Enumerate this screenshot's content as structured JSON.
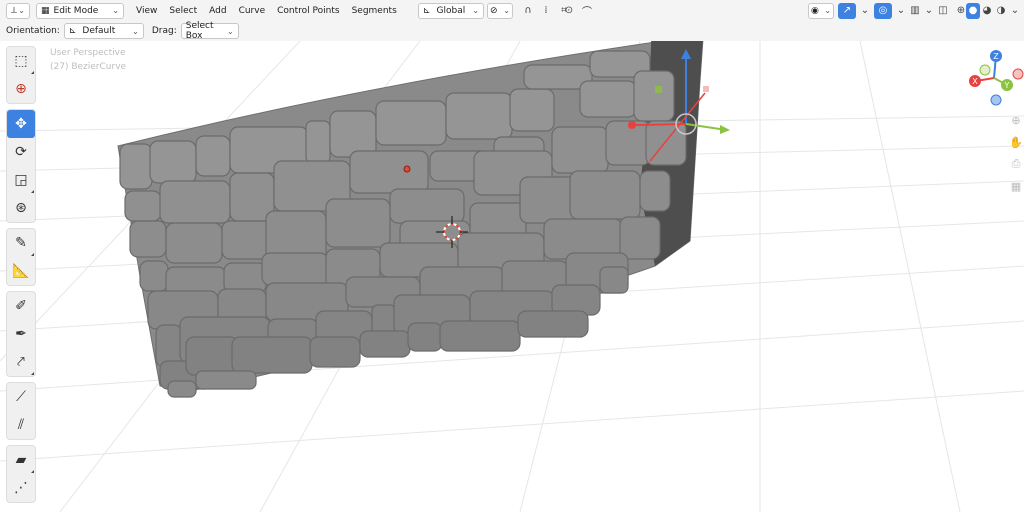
{
  "header": {
    "editor_type_icon": "axes-editor-icon",
    "mode": "Edit Mode",
    "menus": [
      "View",
      "Select",
      "Add",
      "Curve",
      "Control Points",
      "Segments"
    ],
    "transform_orientation": "Global",
    "pivot_icon": "pivot-icon",
    "snap_icon": "snap-magnet-icon",
    "proportional_icon": "proportional-edit-icon",
    "falloff_icon": "falloff-icon"
  },
  "header_right": {
    "visibility_icon": "eye-icon",
    "gizmo_icon": "gizmo-icon",
    "overlay_icon": "overlay-icon",
    "xray_icon": "xray-icon",
    "shading_modes": [
      "wireframe",
      "solid",
      "material-preview",
      "rendered"
    ]
  },
  "toolsettings": {
    "orientation_label": "Orientation:",
    "orientation_value": "Default",
    "drag_label": "Drag:",
    "drag_value": "Select Box"
  },
  "viewport": {
    "view_name": "User Perspective",
    "object_name": "(27) BezierCurve"
  },
  "tools": [
    {
      "name": "select-box",
      "icon": "select-box-icon",
      "active": false
    },
    {
      "name": "cursor",
      "icon": "cursor-icon",
      "active": false
    },
    {
      "name": "move",
      "icon": "move-icon",
      "active": true
    },
    {
      "name": "rotate",
      "icon": "rotate-icon",
      "active": false
    },
    {
      "name": "scale",
      "icon": "scale-icon",
      "active": false
    },
    {
      "name": "transform",
      "icon": "transform-icon",
      "active": false
    },
    {
      "name": "annotate",
      "icon": "annotate-icon",
      "active": false
    },
    {
      "name": "measure",
      "icon": "measure-icon",
      "active": false
    },
    {
      "name": "draw",
      "icon": "draw-icon",
      "active": false
    },
    {
      "name": "pen",
      "icon": "pen-icon",
      "active": false
    },
    {
      "name": "extrude",
      "icon": "extrude-icon",
      "active": false
    },
    {
      "name": "radius",
      "icon": "radius-icon",
      "active": false
    },
    {
      "name": "tilt",
      "icon": "tilt-icon",
      "active": false
    },
    {
      "name": "shear",
      "icon": "shear-icon",
      "active": false
    },
    {
      "name": "randomize",
      "icon": "randomize-icon",
      "active": false
    }
  ],
  "nav_gizmo": {
    "x_label": "X",
    "y_label": "Y",
    "z_label": "Z",
    "colors": {
      "x": "#e8413f",
      "y": "#8bc240",
      "z": "#3d82e0"
    }
  }
}
